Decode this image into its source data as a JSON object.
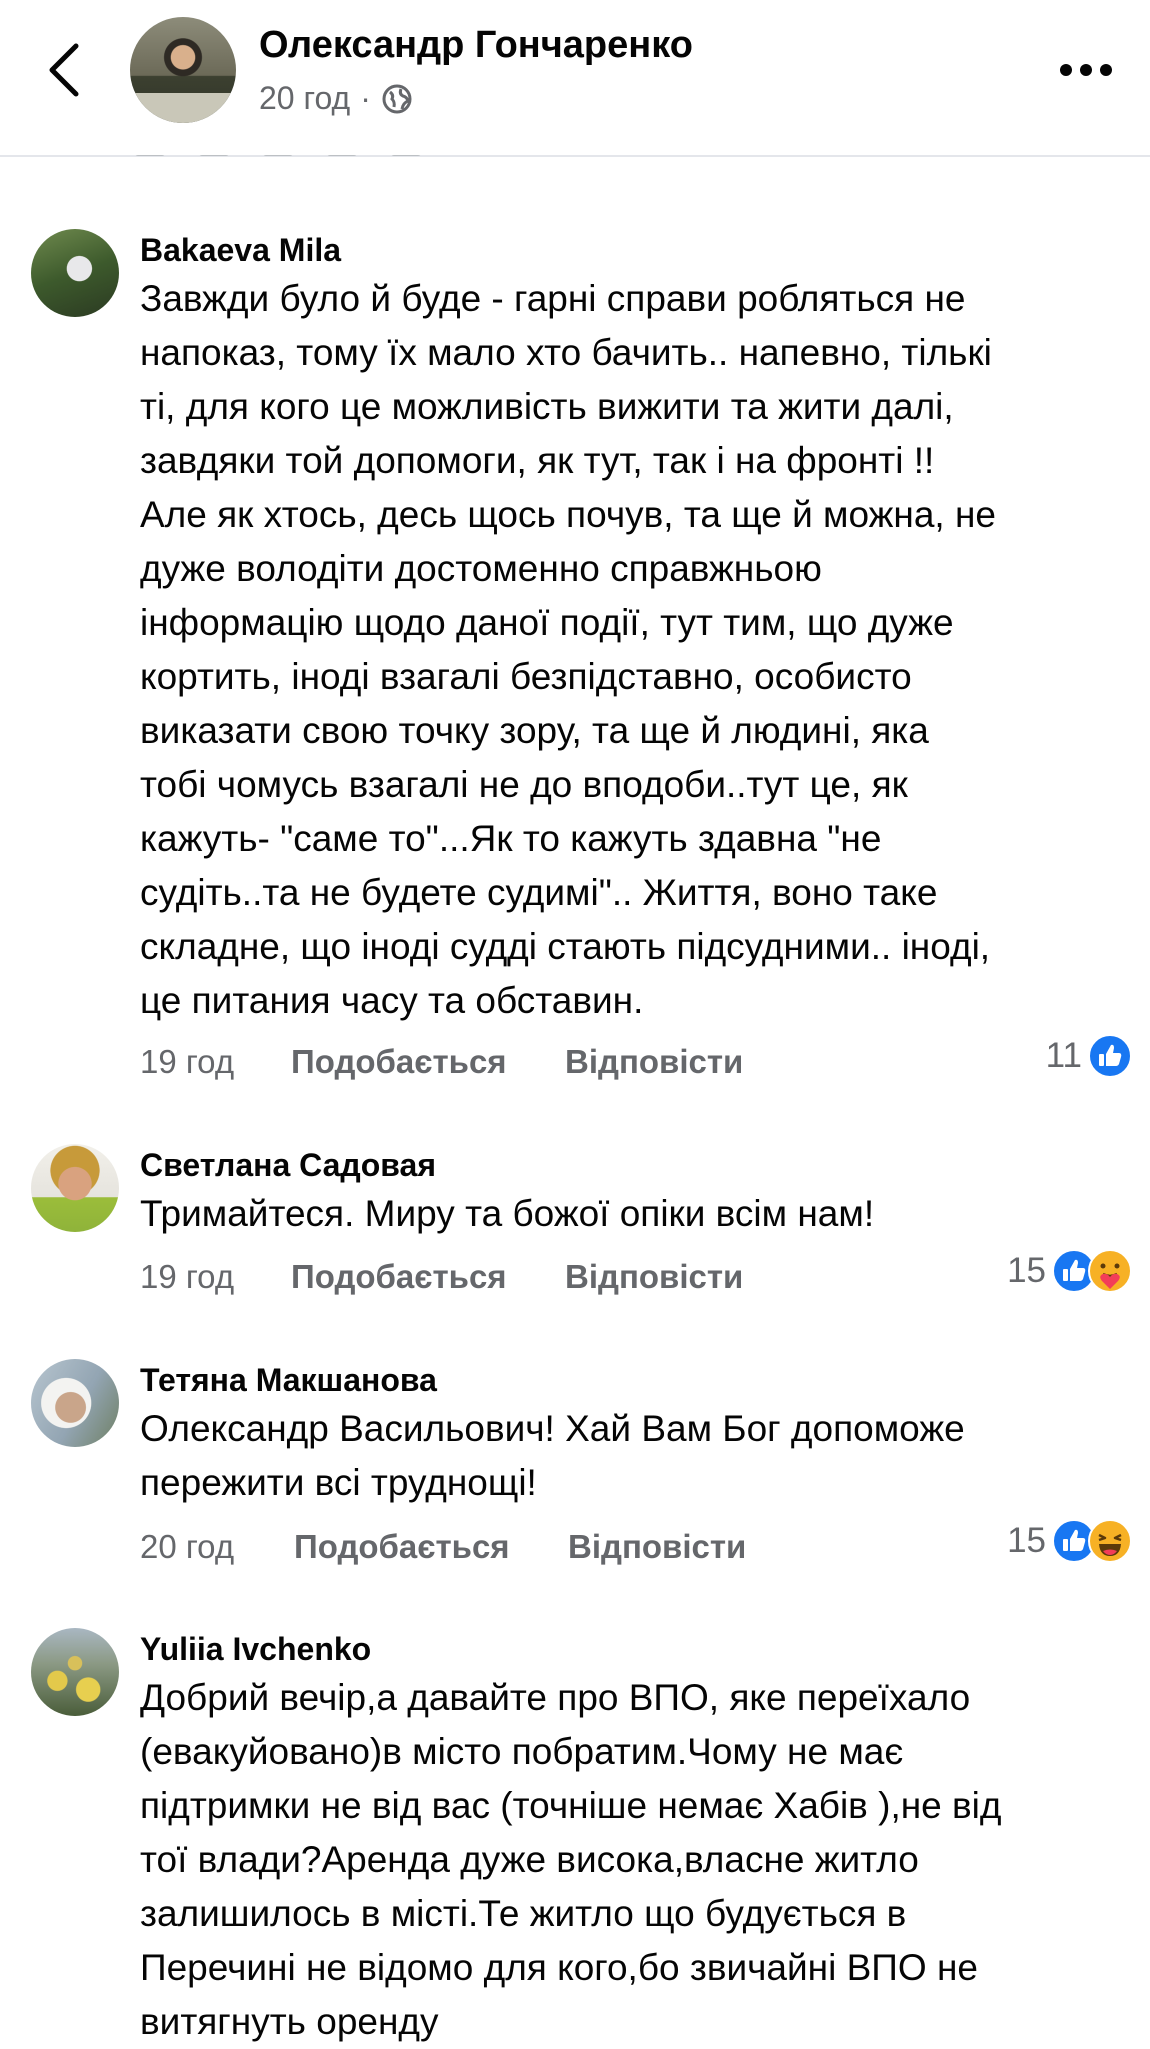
{
  "header": {
    "author": "Олександр Гончаренко",
    "time": "20 год",
    "separator": "·"
  },
  "actions": {
    "like_label": "Подобається",
    "reply_label": "Відповісти"
  },
  "colors": {
    "text": "#050505",
    "secondary": "#65676b",
    "like_blue": "#1877f2",
    "reaction_yellow": "#f7b125"
  },
  "comments": [
    {
      "author": "Bakaeva Mila",
      "lines": [
        "Завжди було й буде - гарні справи робляться не",
        "напоказ, тому їх мало хто бачить.. напевно, тількі",
        "ті,  для кого це можливість вижити  та жити далі,",
        "завдяки той допомоги,  як тут, так і на фронті !!",
        "Але як хтось, десь щось почув, та ще й можна, не",
        "дуже володіти достоменно справжньою",
        "інформацію щодо даної події, тут тим, що дуже",
        "кортить, іноді  взагалі  безпідставно, особисто",
        "виказати свою точку зору,  та ще й людині, яка",
        "тобі чомусь взагалі не до вподоби..тут це, як",
        "кажуть- \"саме то\"...Як то кажуть здавна \"не",
        "судіть..та не будете судимі\".. Життя, воно таке",
        "складне,  що іноді судді стають підсудними.. іноді,",
        "це питания часу та обставин."
      ],
      "time": "19 год",
      "reaction_count": "11",
      "reactions": [
        "like-icon"
      ]
    },
    {
      "author": "Светлана Садовая",
      "lines": [
        "Тримайтеся. Миру та божої опіки всім нам!"
      ],
      "time": "19 год",
      "reaction_count": "15",
      "reactions": [
        "like-icon",
        "care-icon"
      ]
    },
    {
      "author": "Тетяна Макшанова",
      "lines": [
        "Олександр Васильович! Хай Вам Бог допоможе",
        "пережити всі труднощі!"
      ],
      "time": "20 год",
      "reaction_count": "15",
      "reactions": [
        "like-icon",
        "haha-icon"
      ]
    },
    {
      "author": "Yuliia Ivchenko",
      "lines": [
        "Добрий вечір,а давайте про ВПО, яке переїхало",
        "(евакуйовано)в місто побратим.Чому не має",
        "підтримки не від вас (точніше немає Хабів ),не від",
        "тої влади?Аренда дуже висока,власне житло",
        "залишилось в місті.Те житло що будується в",
        "Перечині не відомо для кого,бо звичайні ВПО не",
        "витягнуть оренду"
      ]
    }
  ]
}
